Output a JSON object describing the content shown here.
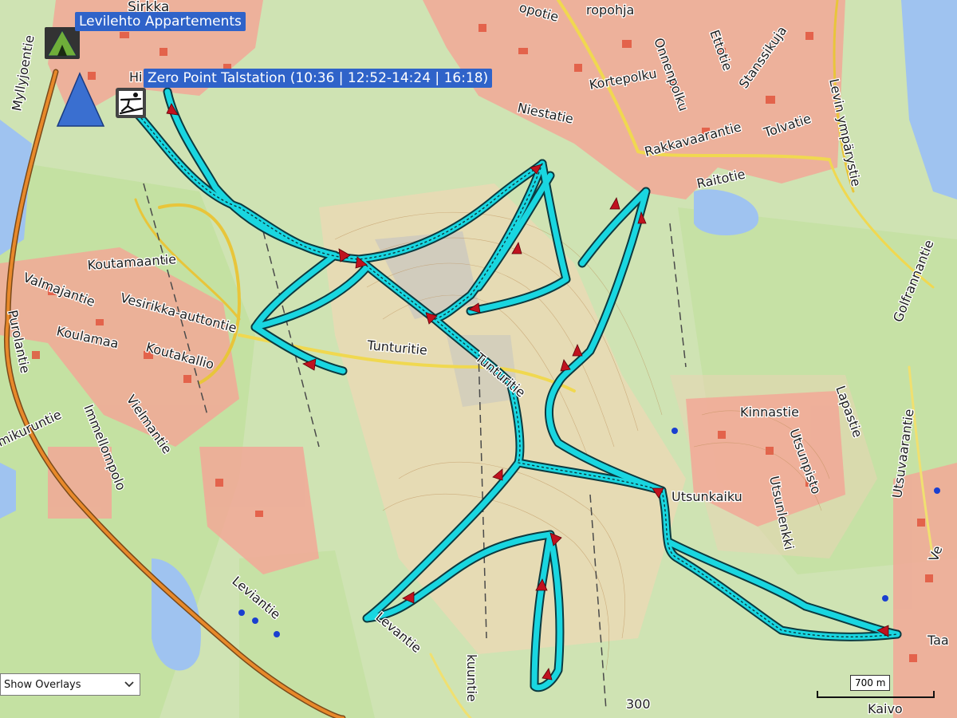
{
  "waypoints": {
    "appartements": "Levilehto Appartements",
    "talstation": "Zero Point Talstation (10:36 | 12:52-14:24 | 16:18)"
  },
  "overlay_select": {
    "value": "Show Overlays"
  },
  "scale": {
    "label": "700 m"
  },
  "map_labels": {
    "sirkka": "Sirkka",
    "myllyjoentie": "Myllyjoentie",
    "hissitie": "Hi",
    "kortepolku": "Kortepolku",
    "onnenpolku": "Onnenpolku",
    "ettotie": "Ettotie",
    "stanssikuja": "Stanssikuja",
    "levin_ymparystie": "Levin ympärystie",
    "niestatie": "Niestatie",
    "tolvatie": "Tolvatie",
    "rakkavaarantie": "Rakkavaarantie",
    "raitotie": "Raitotie",
    "koutamaantie": "Koutamaantie",
    "valmajantie": "Valmajantie",
    "vesirikka": "Vesirikka-auttontie",
    "purolantie": "Purolantie",
    "koulamaa": "Koulamaa",
    "koutakallio": "Koutakallio",
    "tunturitie": "Tunturitie",
    "tunturitie2": "Tunturitie",
    "kinnastie": "Kinnastie",
    "lapastie": "Lapastie",
    "utsunpisto": "Utsunpisto",
    "utsunlenkki": "Utsunlenkki",
    "utsunkaiku": "Utsunkaiku",
    "utsuvaarantie": "Utsuvaarantie",
    "golfrannantie": "Golfrannantie",
    "mikuruntie": "mikuruntie",
    "immellompolo": "Immellompolo",
    "vielmantie": "Vielmantie",
    "leviantie": "Leviantie",
    "levantie": "Levantie",
    "kuuntie": "kuuntie",
    "taa": "Taa",
    "kaivo": "Kaivo",
    "elev": "300",
    "ve": "Ve",
    "nopotie": "opotie",
    "opohja": "ropohja"
  },
  "icons": [
    "campground-icon",
    "waypoint-triangle-icon",
    "skier-icon"
  ],
  "colors": {
    "track": "#19d6e0",
    "track_outline": "#0b3a40",
    "direction_arrow": "#c0121f",
    "callout": "#2f63c9",
    "urban": "#f08c78",
    "forest": "#c9e2a6",
    "water": "#9fc3f0"
  }
}
